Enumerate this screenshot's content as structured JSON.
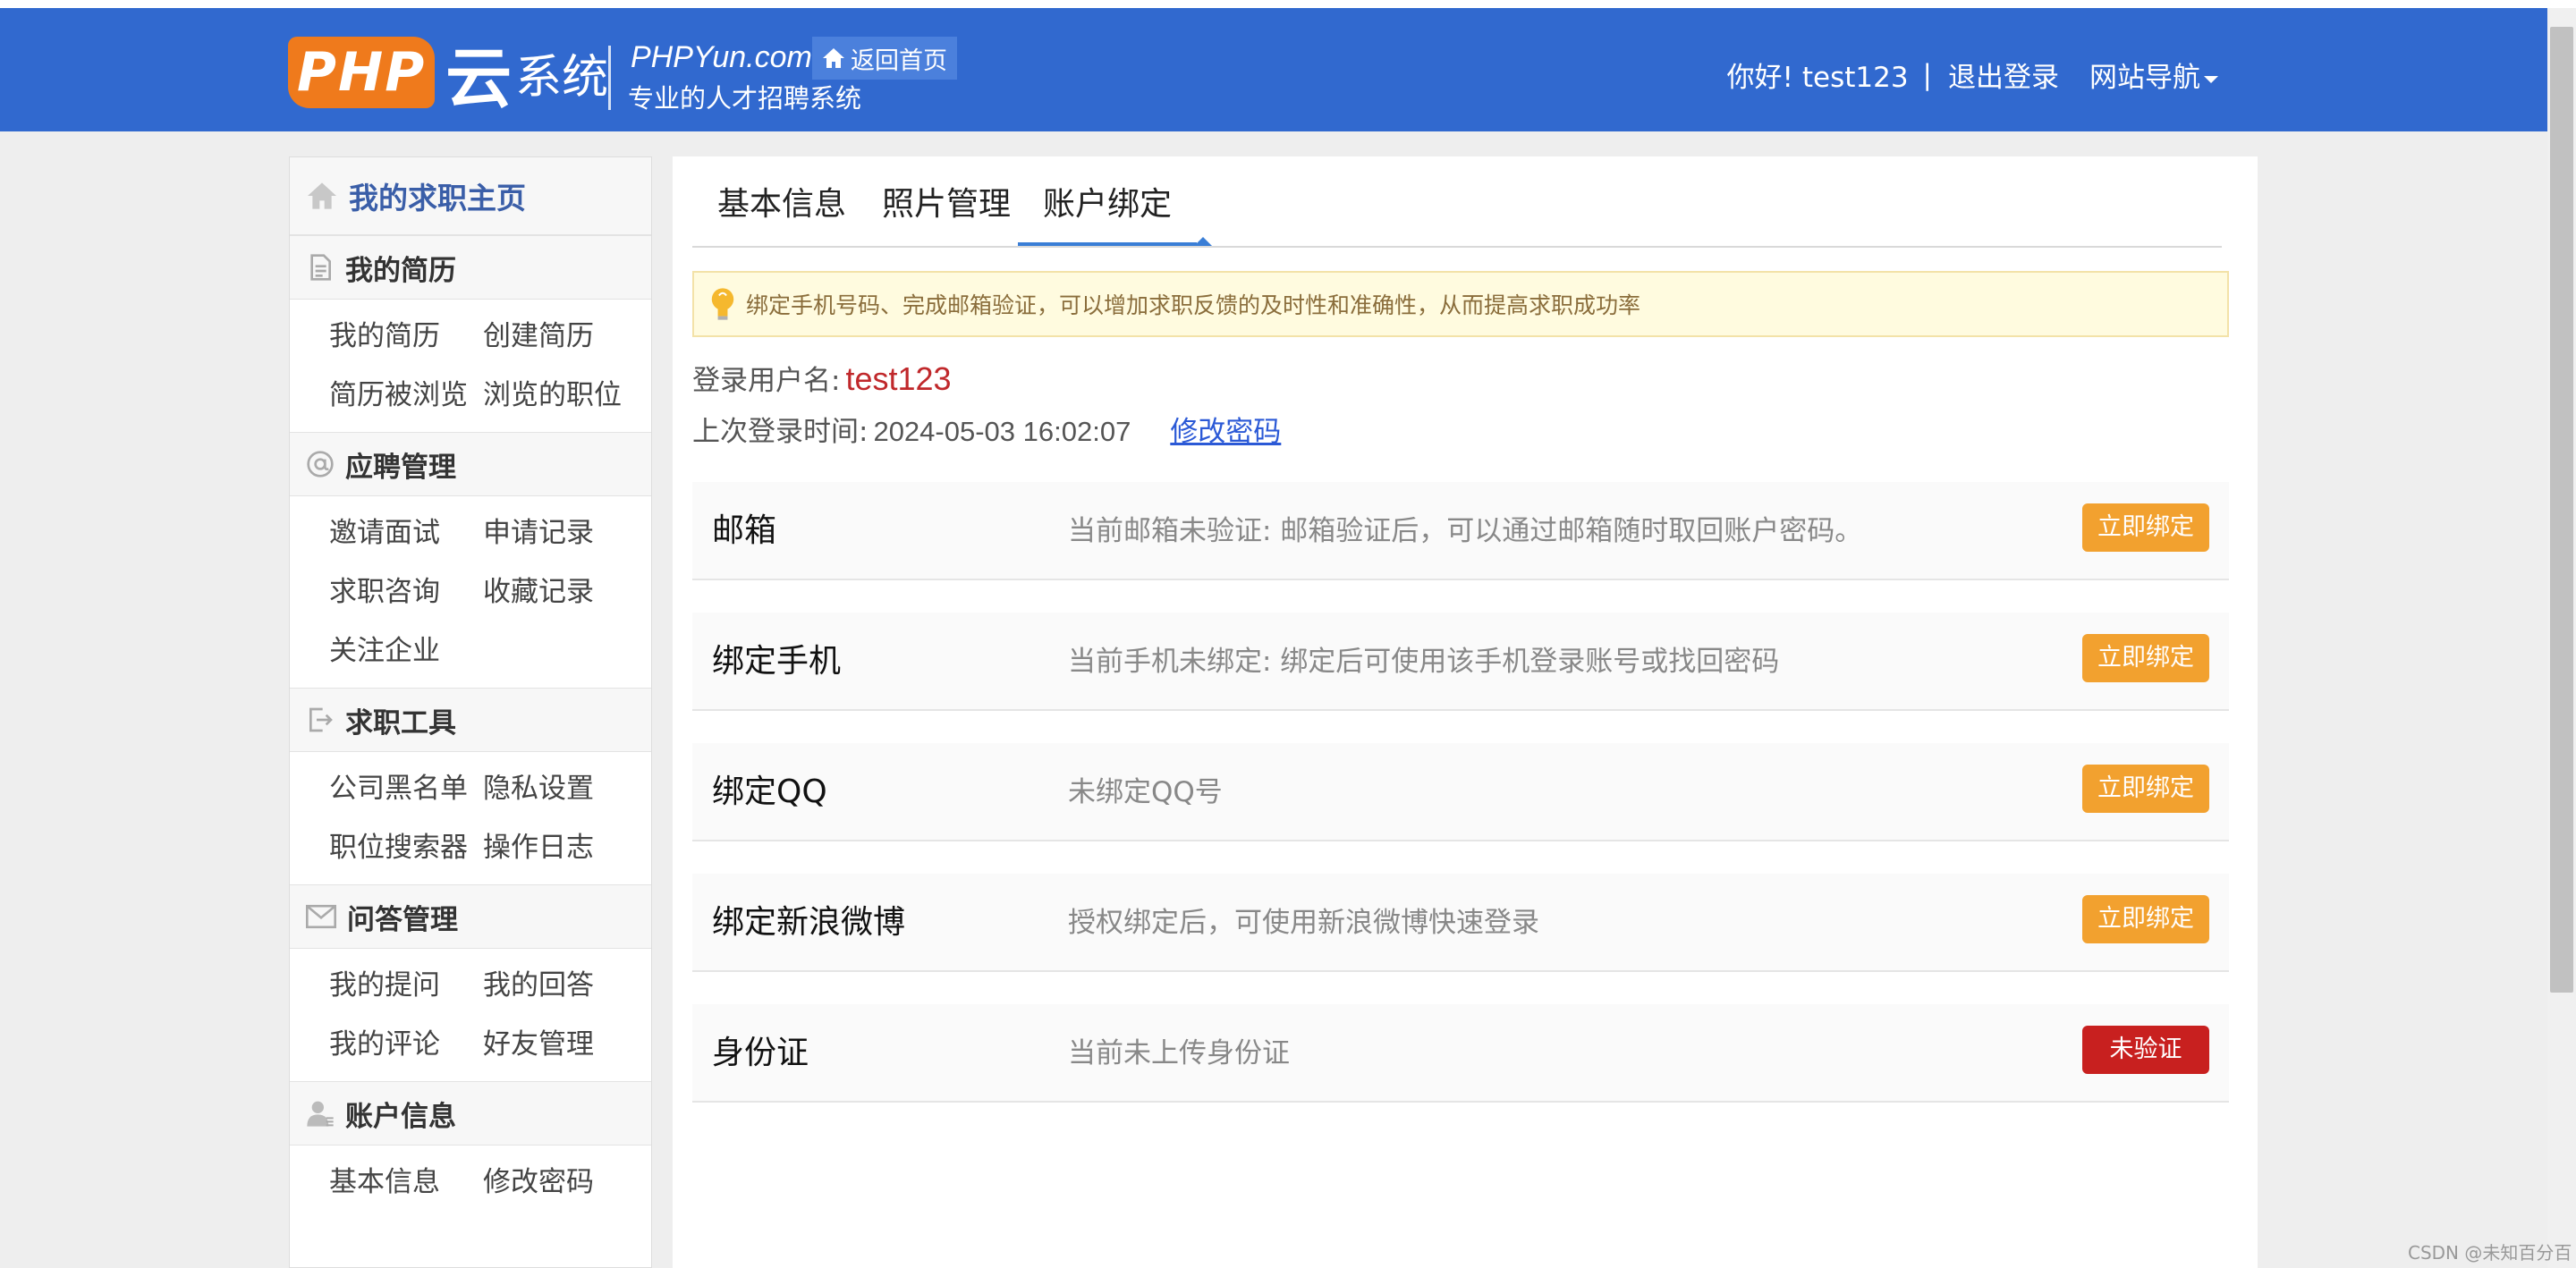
{
  "header": {
    "logo_php": "PHP",
    "logo_yun": "云",
    "logo_sys": "系统",
    "domain": "PHPYun.com",
    "slogan": "专业的人才招聘系统",
    "home_label": "返回首页",
    "greeting": "你好!",
    "username": "test123",
    "separator": "|",
    "logout": "退出登录",
    "site_nav": "网站导航"
  },
  "sidebar": {
    "home_title": "我的求职主页",
    "sections": [
      {
        "title": "我的简历",
        "icon": "document-icon",
        "links": [
          "我的简历",
          "创建简历",
          "简历被浏览",
          "浏览的职位"
        ]
      },
      {
        "title": "应聘管理",
        "icon": "at-icon",
        "links": [
          "邀请面试",
          "申请记录",
          "求职咨询",
          "收藏记录",
          "关注企业"
        ]
      },
      {
        "title": "求职工具",
        "icon": "export-icon",
        "links": [
          "公司黑名单",
          "隐私设置",
          "职位搜索器",
          "操作日志"
        ]
      },
      {
        "title": "问答管理",
        "icon": "envelope-icon",
        "links": [
          "我的提问",
          "我的回答",
          "我的评论",
          "好友管理"
        ]
      },
      {
        "title": "账户信息",
        "icon": "user-icon",
        "links": [
          "基本信息",
          "修改密码"
        ]
      }
    ]
  },
  "tabs": [
    "基本信息",
    "照片管理",
    "账户绑定"
  ],
  "active_tab": "账户绑定",
  "tip": "绑定手机号码、完成邮箱验证，可以增加求职反馈的及时性和准确性，从而提高求职成功率",
  "account": {
    "username_label": "登录用户名:",
    "username": "test123",
    "last_login_label": "上次登录时间:",
    "last_login": "2024-05-03 16:02:07",
    "change_password": "修改密码"
  },
  "bindings": [
    {
      "name": "邮箱",
      "desc": "当前邮箱未验证:  邮箱验证后，可以通过邮箱随时取回账户密码。",
      "button": "立即绑定",
      "status": "orange"
    },
    {
      "name": "绑定手机",
      "desc": "当前手机未绑定:  绑定后可使用该手机登录账号或找回密码",
      "button": "立即绑定",
      "status": "orange"
    },
    {
      "name": "绑定QQ",
      "desc": "未绑定QQ号",
      "button": "立即绑定",
      "status": "orange"
    },
    {
      "name": "绑定新浪微博",
      "desc": "授权绑定后，可使用新浪微博快速登录",
      "button": "立即绑定",
      "status": "orange"
    },
    {
      "name": "身份证",
      "desc": "当前未上传身份证",
      "button": "未验证",
      "status": "red"
    }
  ],
  "colors": {
    "header_bg": "#3169cf",
    "button_orange": "#f2a12f",
    "button_red": "#c8201f",
    "username_red": "#c0282b",
    "link_blue": "#2b59d6"
  },
  "watermark": "CSDN @未知百分百"
}
